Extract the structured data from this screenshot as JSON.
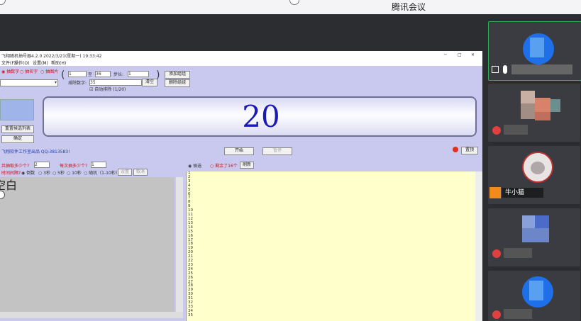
{
  "meeting": {
    "title": "腾讯会议"
  },
  "app": {
    "title": "飞翔随机抽号器4.2.0  2022/3/21(星期一)  19:33:42",
    "window_controls": [
      "─",
      "□",
      "✕"
    ],
    "menu": [
      "文件(F)",
      "操作(O)",
      "设置(M)",
      "帮助(H)"
    ],
    "mode_options": [
      "抽数字",
      "抽名字",
      "抽图片"
    ],
    "range_from": "1",
    "range_to_label": "至",
    "range_to": "36",
    "step_label": "步长:",
    "step_value": "1",
    "exclude_label": "排除数字:",
    "exclude_value": "35",
    "clear_label": "清空",
    "auto_exclude_label": "自动排除",
    "auto_exclude_count": "(1/20)",
    "add_group_label": "添加组组",
    "delete_group_label": "删除组组",
    "reset_list_label": "重置候选列表",
    "ok_label": "确定",
    "display_number": "20",
    "credits": "飞翔软件工作室出品   QQ:3813583!",
    "start_label": "开始",
    "stop_label": "暂停",
    "top_label": "置顶",
    "draw_count_label": "共抽取多少个?",
    "draw_count_value": "2",
    "per_draw_label": "每次抽多少个?",
    "per_draw_value": "1",
    "interval_label": "时间间隔?",
    "interval_options": [
      "倒数",
      "3秒",
      "5秒",
      "10秒",
      "随机（1-10秒）"
    ],
    "set_label": "设置",
    "cancel_label": "取消",
    "candidates_radio": "候选",
    "drawn_radio": "剩余了16个",
    "refresh_label": "刷新",
    "left_big_text": "空白",
    "numbers": [
      "1",
      "2",
      "3",
      "4",
      "5",
      "6",
      "7",
      "8",
      "9",
      "10",
      "11",
      "12",
      "13",
      "14",
      "15",
      "16",
      "17",
      "18",
      "19",
      "20",
      "21",
      "22",
      "23",
      "24",
      "25",
      "26",
      "27",
      "28",
      "29",
      "30",
      "31",
      "32",
      "33",
      "34",
      "35"
    ]
  },
  "participants": [
    {
      "name": ""
    },
    {
      "name": ""
    },
    {
      "name": "牛小猫"
    },
    {
      "name": ""
    },
    {
      "name": ""
    }
  ]
}
